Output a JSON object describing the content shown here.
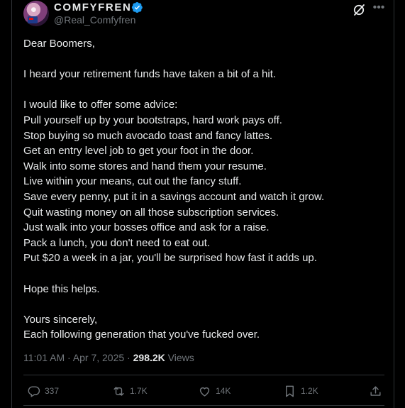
{
  "author": {
    "display_name": "COMFYFREN",
    "handle": "@Real_Comfyfren",
    "verified": true,
    "verified_color": "#1d9bf0"
  },
  "post": {
    "text": "Dear Boomers,\n\nI heard your retirement funds have taken a bit of a hit.\n\nI would like to offer some advice:\nPull yourself up by your bootstraps, hard work pays off.\nStop buying so much avocado toast and fancy lattes.\nGet an entry level job to get your foot in the door.\nWalk into some stores and hand them your resume.\nLive within your means, cut out the fancy stuff.\nSave every penny, put it in a savings account and watch it grow.\nQuit wasting money on all those subscription services.\nJust walk into your bosses office and ask for a raise.\nPack a lunch, you don't need to eat out.\nPut $20 a week in a jar, you'll be surprised how fast it adds up.\n\nHope this helps.\n\nYours sincerely,\nEach following generation that you've fucked over.",
    "timestamp": "11:01 AM · Apr 7, 2025",
    "separator": " · ",
    "views_count": "298.2K",
    "views_label": "Views"
  },
  "actions": {
    "replies": "337",
    "reposts": "1.7K",
    "likes": "14K",
    "bookmarks": "1.2K"
  },
  "icons": [
    "grok-icon",
    "more-icon",
    "reply-icon",
    "repost-icon",
    "like-icon",
    "bookmark-icon",
    "share-icon",
    "verified-badge-icon"
  ]
}
